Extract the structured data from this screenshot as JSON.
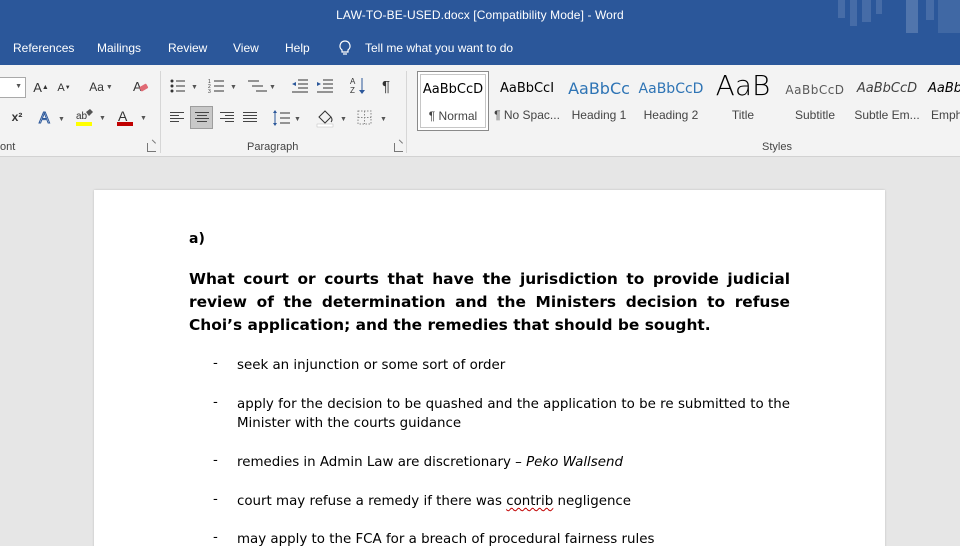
{
  "window": {
    "title": "LAW-TO-BE-USED.docx [Compatibility Mode]  -  Word"
  },
  "menu": {
    "tabs": [
      "References",
      "Mailings",
      "Review",
      "View",
      "Help"
    ],
    "tell_me": "Tell me what you want to do"
  },
  "ribbon": {
    "groups": {
      "font": "ont",
      "paragraph": "Paragraph",
      "styles": "Styles"
    },
    "font_buttons": {
      "change_case": "Aa",
      "superscript": "x²"
    },
    "styles_gallery": [
      {
        "preview": "AaBbCcD",
        "name": "¶ Normal",
        "selected": true
      },
      {
        "preview": "AaBbCcI",
        "name": "¶ No Spac..."
      },
      {
        "preview": "AaBbCc",
        "name": "Heading 1"
      },
      {
        "preview": "AaBbCcD",
        "name": "Heading 2"
      },
      {
        "preview": "AaB",
        "name": "Title"
      },
      {
        "preview": "AaBbCcD",
        "name": "Subtitle"
      },
      {
        "preview": "AaBbCcD",
        "name": "Subtle Em..."
      },
      {
        "preview": "AaBb",
        "name": "Emph"
      }
    ]
  },
  "document": {
    "section": "a)",
    "heading": "What court or courts that have the jurisdiction to provide judicial review of the determination and the Ministers decision to refuse Choi’s application; and the remedies that should be sought.",
    "bullet_char": "-",
    "bullets": {
      "b1": "seek an injunction or some sort of order",
      "b2": "apply for the decision to be quashed and the application to be re submitted to the Minister with the courts guidance",
      "b3_text": "remedies in Admin Law are discretionary – ",
      "b3_case": "Peko Wallsend",
      "b4_pre": "court may refuse a remedy if there was ",
      "b4_misspelled": "contrib",
      "b4_post": " negligence",
      "b5": "may apply to the FCA for a breach of procedural fairness rules"
    }
  },
  "colors": {
    "accent": "#2b579a",
    "ribbon": "#f3f3f3",
    "canvas": "#e6e6e6",
    "font_color_red": "#c00000",
    "highlight_yellow": "#ffff00"
  }
}
